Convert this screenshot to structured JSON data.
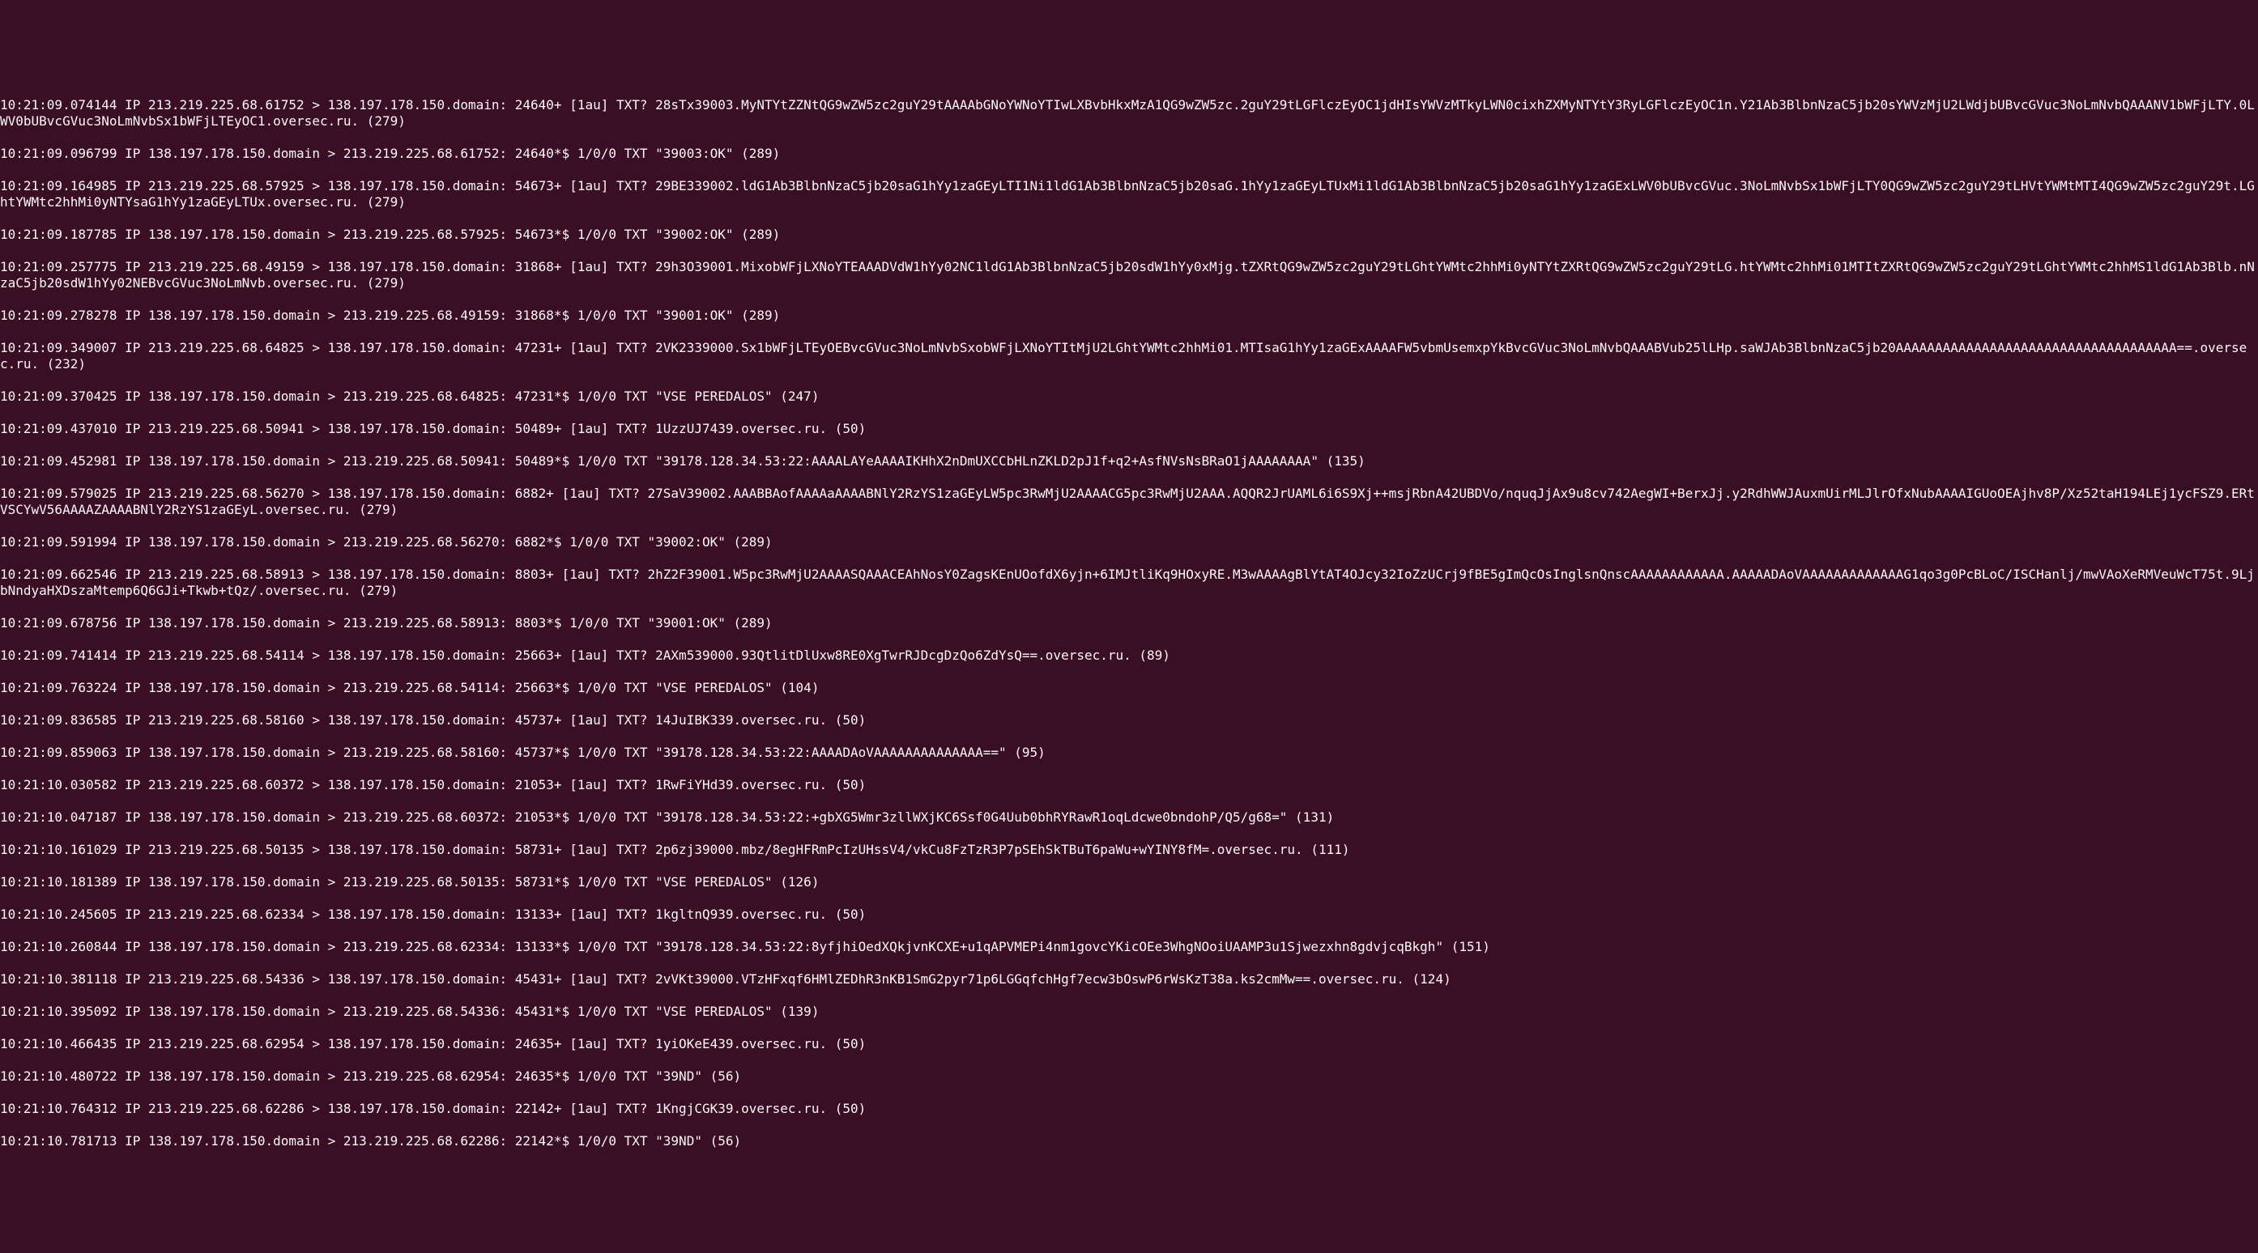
{
  "terminal": {
    "lines": [
      "10:21:09.074144 IP 213.219.225.68.61752 > 138.197.178.150.domain: 24640+ [1au] TXT? 28sTx39003.MyNTYtZZNtQG9wZW5zc2guY29tAAAAbGNoYWNoYTIwLXBvbHkxMzA1QG9wZW5zc.2guY29tLGFlczEyOC1jdHIsYWVzMTkyLWN0cixhZXMyNTYtY3RyLGFlczEyOC1n.Y21Ab3BlbnNzaC5jb20sYWVzMjU2LWdjbUBvcGVuc3NoLmNvbQAAANV1bWFjLTY.0LWV0bUBvcGVuc3NoLmNvbSx1bWFjLTEyOC1.oversec.ru. (279)",
      "10:21:09.096799 IP 138.197.178.150.domain > 213.219.225.68.61752: 24640*$ 1/0/0 TXT \"39003:OK\" (289)",
      "10:21:09.164985 IP 213.219.225.68.57925 > 138.197.178.150.domain: 54673+ [1au] TXT? 29BE339002.ldG1Ab3BlbnNzaC5jb20saG1hYy1zaGEyLTI1Ni1ldG1Ab3BlbnNzaC5jb20saG.1hYy1zaGEyLTUxMi1ldG1Ab3BlbnNzaC5jb20saG1hYy1zaGExLWV0bUBvcGVuc.3NoLmNvbSx1bWFjLTY0QG9wZW5zc2guY29tLHVtYWMtMTI4QG9wZW5zc2guY29t.LGhtYWMtc2hhMi0yNTYsaG1hYy1zaGEyLTUx.oversec.ru. (279)",
      "10:21:09.187785 IP 138.197.178.150.domain > 213.219.225.68.57925: 54673*$ 1/0/0 TXT \"39002:OK\" (289)",
      "10:21:09.257775 IP 213.219.225.68.49159 > 138.197.178.150.domain: 31868+ [1au] TXT? 29h3O39001.MixobWFjLXNoYTEAAADVdW1hYy02NC1ldG1Ab3BlbnNzaC5jb20sdW1hYy0xMjg.tZXRtQG9wZW5zc2guY29tLGhtYWMtc2hhMi0yNTYtZXRtQG9wZW5zc2guY29tLG.htYWMtc2hhMi01MTItZXRtQG9wZW5zc2guY29tLGhtYWMtc2hhMS1ldG1Ab3Blb.nNzaC5jb20sdW1hYy02NEBvcGVuc3NoLmNvb.oversec.ru. (279)",
      "10:21:09.278278 IP 138.197.178.150.domain > 213.219.225.68.49159: 31868*$ 1/0/0 TXT \"39001:OK\" (289)",
      "10:21:09.349007 IP 213.219.225.68.64825 > 138.197.178.150.domain: 47231+ [1au] TXT? 2VK2339000.Sx1bWFjLTEyOEBvcGVuc3NoLmNvbSxobWFjLXNoYTItMjU2LGhtYWMtc2hhMi01.MTIsaG1hYy1zaGExAAAAFW5vbmUsemxpYkBvcGVuc3NoLmNvbQAAABVub25lLHp.saWJAb3BlbnNzaC5jb20AAAAAAAAAAAAAAAAAAAAAAAAAAAAAAAAAAAA==.oversec.ru. (232)",
      "10:21:09.370425 IP 138.197.178.150.domain > 213.219.225.68.64825: 47231*$ 1/0/0 TXT \"VSE PEREDALOS\" (247)",
      "10:21:09.437010 IP 213.219.225.68.50941 > 138.197.178.150.domain: 50489+ [1au] TXT? 1UzzUJ7439.oversec.ru. (50)",
      "10:21:09.452981 IP 138.197.178.150.domain > 213.219.225.68.50941: 50489*$ 1/0/0 TXT \"39178.128.34.53:22:AAAALAYeAAAAIKHhX2nDmUXCCbHLnZKLD2pJ1f+q2+AsfNVsNsBRaO1jAAAAAAAA\" (135)",
      "10:21:09.579025 IP 213.219.225.68.56270 > 138.197.178.150.domain: 6882+ [1au] TXT? 27SaV39002.AAABBAofAAAAaAAAABNlY2RzYS1zaGEyLW5pc3RwMjU2AAAACG5pc3RwMjU2AAA.AQQR2JrUAML6i6S9Xj++msjRbnA42UBDVo/nquqJjAx9u8cv742AegWI+BerxJj.y2RdhWWJAuxmUirMLJlrOfxNubAAAAIGUoOEAjhv8P/Xz52taH194LEj1ycFSZ9.ERtVSCYwV56AAAAZAAAABNlY2RzYS1zaGEyL.oversec.ru. (279)",
      "10:21:09.591994 IP 138.197.178.150.domain > 213.219.225.68.56270: 6882*$ 1/0/0 TXT \"39002:OK\" (289)",
      "10:21:09.662546 IP 213.219.225.68.58913 > 138.197.178.150.domain: 8803+ [1au] TXT? 2hZ2F39001.W5pc3RwMjU2AAAASQAAACEAhNosY0ZagsKEnUOofdX6yjn+6IMJtliKq9HOxyRE.M3wAAAAgBlYtAT4OJcy32IoZzUCrj9fBE5gImQcOsInglsnQnscAAAAAAAAAAAA.AAAAADAoVAAAAAAAAAAAAAG1qo3g0PcBLoC/ISCHanlj/mwVAoXeRMVeuWcT75t.9LjbNndyaHXDszaMtemp6Q6GJi+Tkwb+tQz/.oversec.ru. (279)",
      "10:21:09.678756 IP 138.197.178.150.domain > 213.219.225.68.58913: 8803*$ 1/0/0 TXT \"39001:OK\" (289)",
      "10:21:09.741414 IP 213.219.225.68.54114 > 138.197.178.150.domain: 25663+ [1au] TXT? 2AXm539000.93QtlitDlUxw8RE0XgTwrRJDcgDzQo6ZdYsQ==.oversec.ru. (89)",
      "10:21:09.763224 IP 138.197.178.150.domain > 213.219.225.68.54114: 25663*$ 1/0/0 TXT \"VSE PEREDALOS\" (104)",
      "10:21:09.836585 IP 213.219.225.68.58160 > 138.197.178.150.domain: 45737+ [1au] TXT? 14JuIBK339.oversec.ru. (50)",
      "10:21:09.859063 IP 138.197.178.150.domain > 213.219.225.68.58160: 45737*$ 1/0/0 TXT \"39178.128.34.53:22:AAAADAoVAAAAAAAAAAAAAA==\" (95)",
      "10:21:10.030582 IP 213.219.225.68.60372 > 138.197.178.150.domain: 21053+ [1au] TXT? 1RwFiYHd39.oversec.ru. (50)",
      "10:21:10.047187 IP 138.197.178.150.domain > 213.219.225.68.60372: 21053*$ 1/0/0 TXT \"39178.128.34.53:22:+gbXG5Wmr3zllWXjKC6Ssf0G4Uub0bhRYRawR1oqLdcwe0bndohP/Q5/g68=\" (131)",
      "10:21:10.161029 IP 213.219.225.68.50135 > 138.197.178.150.domain: 58731+ [1au] TXT? 2p6zj39000.mbz/8egHFRmPcIzUHssV4/vkCu8FzTzR3P7pSEhSkTBuT6paWu+wYINY8fM=.oversec.ru. (111)",
      "10:21:10.181389 IP 138.197.178.150.domain > 213.219.225.68.50135: 58731*$ 1/0/0 TXT \"VSE PEREDALOS\" (126)",
      "10:21:10.245605 IP 213.219.225.68.62334 > 138.197.178.150.domain: 13133+ [1au] TXT? 1kgltnQ939.oversec.ru. (50)",
      "10:21:10.260844 IP 138.197.178.150.domain > 213.219.225.68.62334: 13133*$ 1/0/0 TXT \"39178.128.34.53:22:8yfjhiOedXQkjvnKCXE+u1qAPVMEPi4nm1govcYKicOEe3WhgNOoiUAAMP3u1Sjwezxhn8gdvjcqBkgh\" (151)",
      "10:21:10.381118 IP 213.219.225.68.54336 > 138.197.178.150.domain: 45431+ [1au] TXT? 2vVKt39000.VTzHFxqf6HMlZEDhR3nKB1SmG2pyr71p6LGGqfchHgf7ecw3bOswP6rWsKzT38a.ks2cmMw==.oversec.ru. (124)",
      "10:21:10.395092 IP 138.197.178.150.domain > 213.219.225.68.54336: 45431*$ 1/0/0 TXT \"VSE PEREDALOS\" (139)",
      "10:21:10.466435 IP 213.219.225.68.62954 > 138.197.178.150.domain: 24635+ [1au] TXT? 1yiOKeE439.oversec.ru. (50)",
      "10:21:10.480722 IP 138.197.178.150.domain > 213.219.225.68.62954: 24635*$ 1/0/0 TXT \"39ND\" (56)",
      "10:21:10.764312 IP 213.219.225.68.62286 > 138.197.178.150.domain: 22142+ [1au] TXT? 1KngjCGK39.oversec.ru. (50)",
      "10:21:10.781713 IP 138.197.178.150.domain > 213.219.225.68.62286: 22142*$ 1/0/0 TXT \"39ND\" (56)"
    ]
  }
}
